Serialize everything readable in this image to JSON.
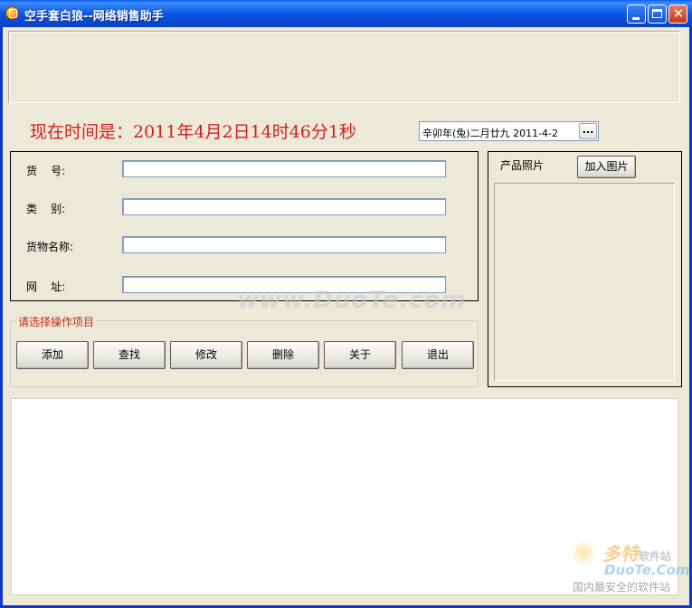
{
  "window": {
    "title": "空手套白狼--网络销售助手",
    "titlebar_color": "#0a5df4",
    "icon": "app-orange-icon",
    "controls": {
      "minimize_icon": "minimize-icon",
      "maximize_icon": "maximize-icon",
      "close_icon": "close-icon"
    }
  },
  "clock": {
    "text": "现在时间是：2011年4月2日14时46分1秒",
    "color": "#d31f1f"
  },
  "date_picker": {
    "value": "辛卯年(兔)二月廿九 2011-4-2",
    "button_label": "..."
  },
  "fields": [
    {
      "label": "货    号:",
      "value": ""
    },
    {
      "label": "类    别:",
      "value": ""
    },
    {
      "label": "货物名称:",
      "value": ""
    },
    {
      "label": "网    址:",
      "value": ""
    }
  ],
  "operations": {
    "legend": "请选择操作项目",
    "legend_color": "#c42b1c",
    "buttons": [
      "添加",
      "查找",
      "修改",
      "删除",
      "关于",
      "退出"
    ]
  },
  "photo": {
    "label": "产品照片",
    "add_button": "加入图片"
  },
  "output": {
    "text": ""
  },
  "watermarks": {
    "center": "www.DuoTe.com",
    "logo_line1": "多特",
    "logo_line1_small": "软件站",
    "logo_line2": "DuoTe.Com",
    "logo_line3": "国内最安全的软件站"
  }
}
